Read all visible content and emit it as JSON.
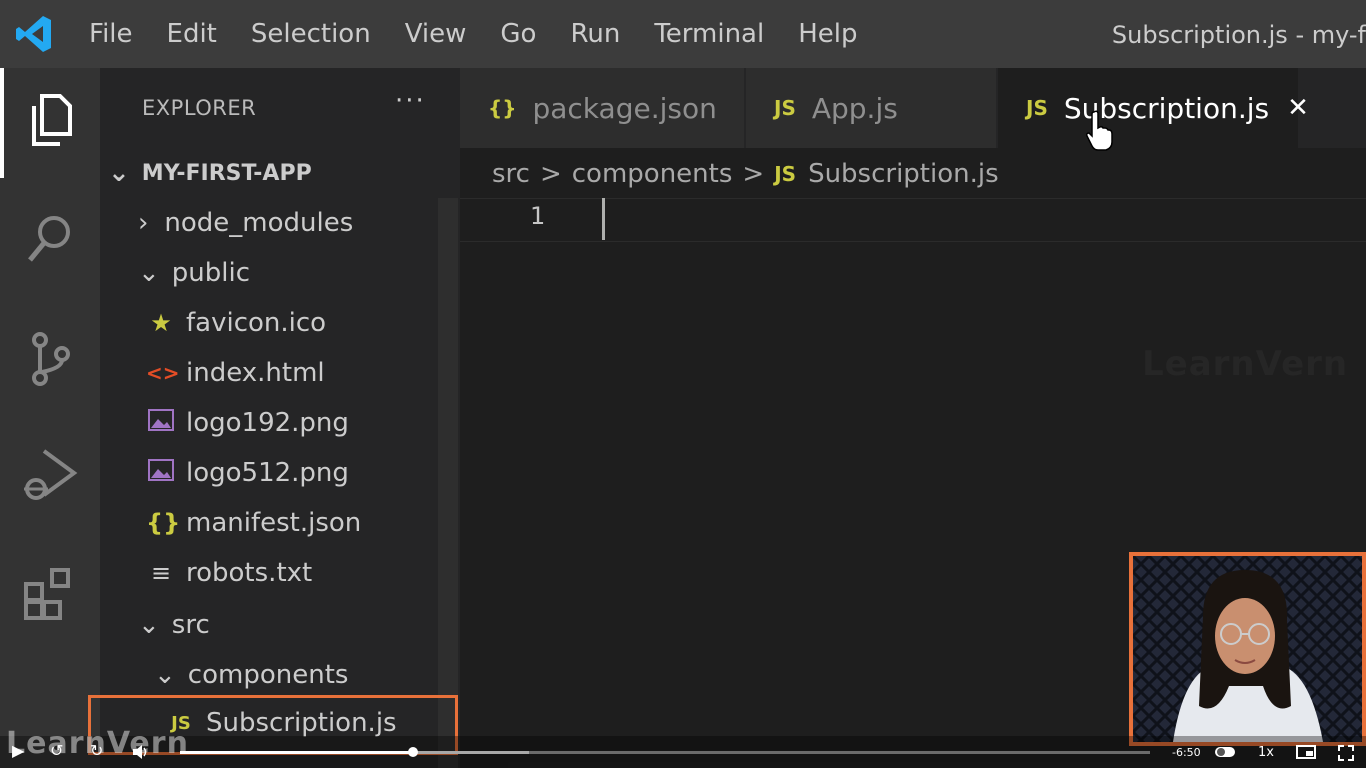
{
  "menubar": {
    "items": [
      "File",
      "Edit",
      "Selection",
      "View",
      "Go",
      "Run",
      "Terminal",
      "Help"
    ],
    "window_title": "Subscription.js - my-f"
  },
  "activity_bar": {
    "icons": [
      "files-icon",
      "search-icon",
      "source-control-icon",
      "run-debug-icon",
      "extensions-icon"
    ]
  },
  "explorer": {
    "header": "EXPLORER",
    "more": "···",
    "root": "MY-FIRST-APP",
    "items": [
      {
        "label": "node_modules",
        "icon": "chevron-right"
      },
      {
        "label": "public",
        "icon": "chevron-down"
      },
      {
        "label": "favicon.ico",
        "icon": "star-icon"
      },
      {
        "label": "index.html",
        "icon": "html-icon"
      },
      {
        "label": "logo192.png",
        "icon": "image-icon"
      },
      {
        "label": "logo512.png",
        "icon": "image-icon"
      },
      {
        "label": "manifest.json",
        "icon": "json-icon"
      },
      {
        "label": "robots.txt",
        "icon": "text-file-icon"
      },
      {
        "label": "src",
        "icon": "chevron-down"
      },
      {
        "label": "components",
        "icon": "chevron-down"
      },
      {
        "label": "Subscription.js",
        "icon": "js-icon"
      }
    ]
  },
  "tabs": [
    {
      "icon_text": "{}",
      "label": "package.json"
    },
    {
      "icon_text": "JS",
      "label": "App.js"
    },
    {
      "icon_text": "JS",
      "label": "Subscription.js",
      "close": "✕",
      "active": true
    }
  ],
  "breadcrumb": {
    "parts": [
      "src",
      "components"
    ],
    "sep": ">",
    "file_icon": "JS",
    "file": "Subscription.js"
  },
  "editor": {
    "line_number": "1",
    "watermark": "LearnVern"
  },
  "player": {
    "time": "-6:50",
    "speed": "1x",
    "progress": 0.24,
    "buffered": 0.36,
    "watermark": "LearnVern"
  },
  "colors": {
    "accent_orange": "#e8713a",
    "js_yellow": "#cbcb41",
    "html_orange": "#e44d26",
    "image_purple": "#a074c4"
  }
}
